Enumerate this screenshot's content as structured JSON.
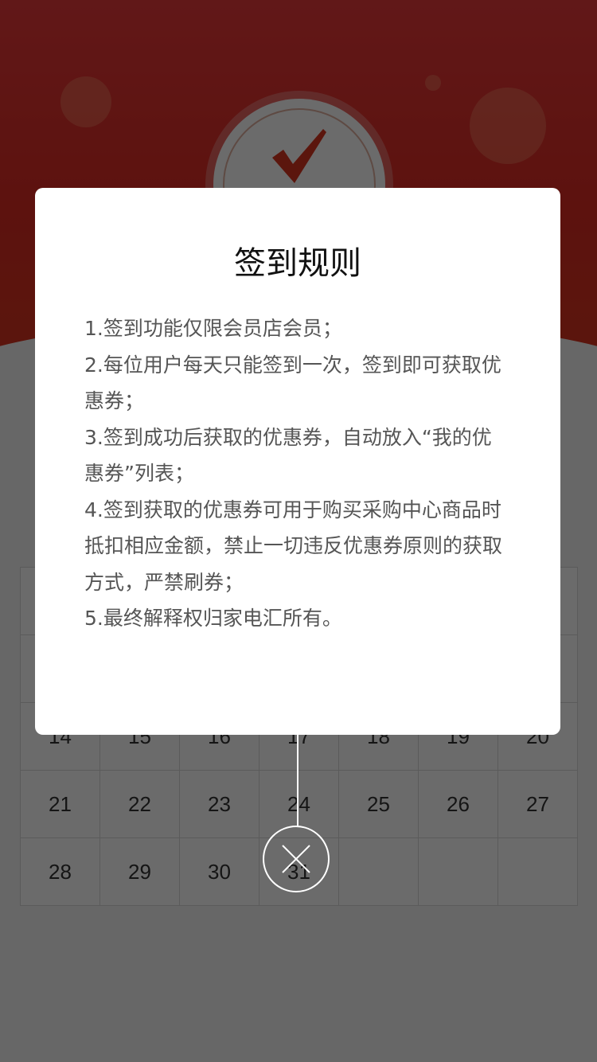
{
  "calendar": {
    "rows": [
      [
        "",
        "",
        "",
        "",
        "",
        "",
        ""
      ],
      [
        "",
        "",
        "",
        "",
        "",
        "",
        ""
      ],
      [
        "14",
        "15",
        "16",
        "17",
        "18",
        "19",
        "20"
      ],
      [
        "21",
        "22",
        "23",
        "24",
        "25",
        "26",
        "27"
      ],
      [
        "28",
        "29",
        "30",
        "31",
        "",
        "",
        ""
      ]
    ]
  },
  "dialog": {
    "title": "签到规则",
    "lines": [
      "1.签到功能仅限会员店会员；",
      "2.每位用户每天只能签到一次，签到即可获取优",
      "惠券；",
      "3.签到成功后获取的优惠券，自动放入“我的优",
      "惠券”列表；",
      "4.签到获取的优惠券可用于购买采购中心商品时",
      "抵扣相应金额，禁止一切违反优惠券原则的获取",
      "方式，严禁刷券；",
      "5.最终解释权归家电汇所有。"
    ]
  },
  "icons": {
    "checkin": "check-icon",
    "close": "close-icon"
  },
  "colors": {
    "header_red": "#dd2c23",
    "check_red": "#d9361f",
    "overlay": "rgba(0,0,0,0.58)"
  }
}
